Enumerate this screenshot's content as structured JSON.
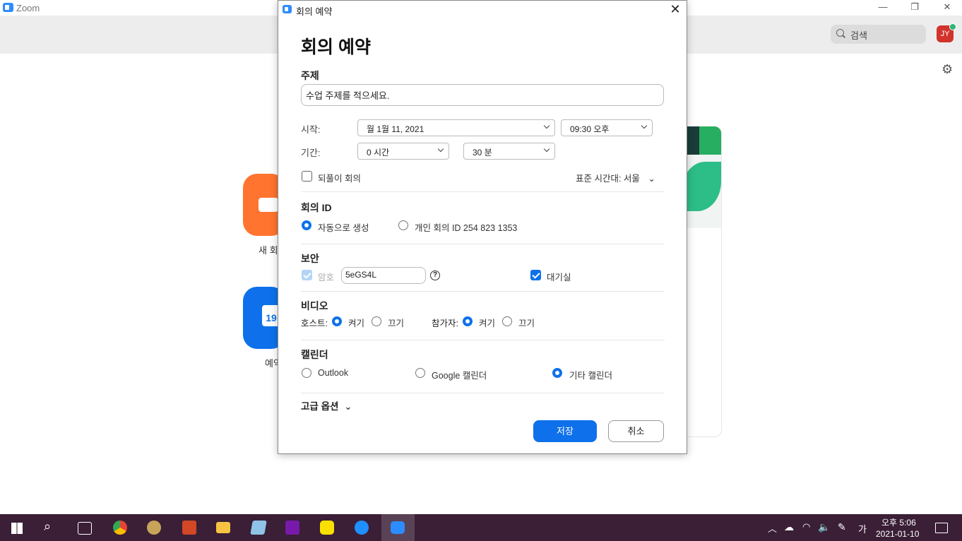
{
  "app": {
    "title": "Zoom",
    "window_controls": [
      "—",
      "❐",
      "✕"
    ]
  },
  "header": {
    "search_placeholder": "검색",
    "avatar_initials": "JY"
  },
  "home": {
    "tile_new_meeting": "새 회",
    "tile_schedule": "예약",
    "calendar_day": "19"
  },
  "dialog": {
    "window_title": "회의 예약",
    "heading": "회의 예약",
    "topic_label": "주제",
    "topic_value": "수업 주제를 적으세요.",
    "start_label": "시작:",
    "start_date": "월  1월  11,  2021",
    "start_time": "09:30  오후",
    "duration_label": "기간:",
    "duration_hours": "0 시간",
    "duration_minutes": "30 분",
    "recurring_label": "되풀이 회의",
    "timezone": "표준 시간대: 서울",
    "meeting_id_label": "회의 ID",
    "meeting_id_auto": "자동으로 생성",
    "meeting_id_personal": "개인 회의 ID 254 823 1353",
    "security_label": "보안",
    "password_label": "암호",
    "password_value": "5eGS4L",
    "waiting_room_label": "대기실",
    "video_label": "비디오",
    "host_label": "호스트:",
    "participant_label": "참가자:",
    "on_label": "켜기",
    "off_label": "끄기",
    "calendar_label": "캘린더",
    "cal_outlook": "Outlook",
    "cal_google": "Google 캘린더",
    "cal_other": "기타 캘린더",
    "advanced_label": "고급 옵션",
    "save_label": "저장",
    "cancel_label": "취소"
  },
  "taskbar": {
    "time": "오후 5:06",
    "date": "2021-01-10",
    "ime": "가"
  },
  "colors": {
    "accent": "#0E71EB",
    "orange": "#FF742E",
    "taskbar": "#3a1f36"
  }
}
